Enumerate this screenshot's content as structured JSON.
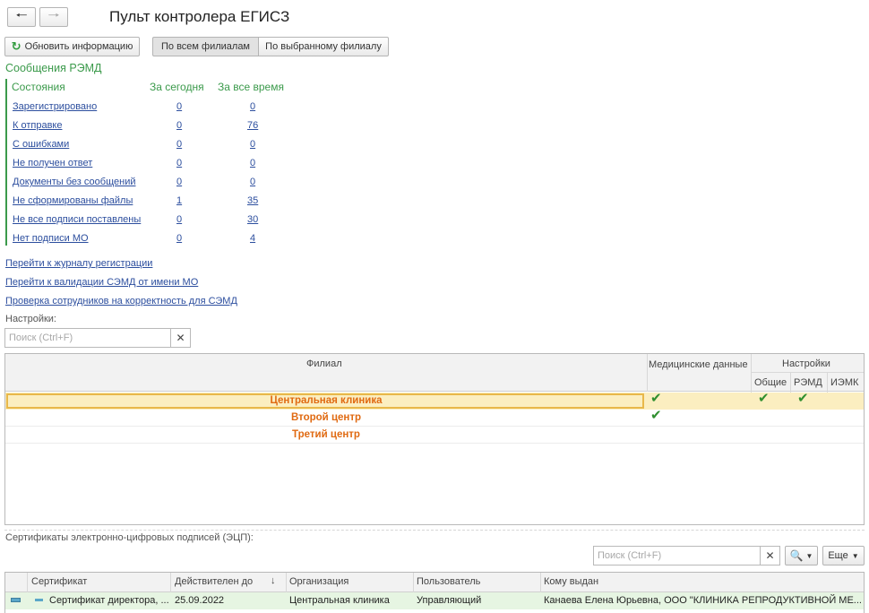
{
  "window": {
    "title": "Пульт контролера ЕГИСЗ"
  },
  "toolbar": {
    "refresh_label": "Обновить информацию",
    "filter_all": "По всем филиалам",
    "filter_selected": "По выбранному филиалу"
  },
  "remd": {
    "section_title": "Сообщения РЭМД",
    "header": {
      "state": "Состояния",
      "today": "За сегодня",
      "all_time": "За все время"
    },
    "rows": [
      {
        "label": "Зарегистрировано",
        "today": "0",
        "all": "0"
      },
      {
        "label": "К отправке",
        "today": "0",
        "all": "76"
      },
      {
        "label": "С ошибками",
        "today": "0",
        "all": "0"
      },
      {
        "label": "Не получен ответ",
        "today": "0",
        "all": "0"
      },
      {
        "label": "Документы без сообщений",
        "today": "0",
        "all": "0"
      },
      {
        "label": "Не сформированы файлы",
        "today": "1",
        "all": "35"
      },
      {
        "label": "Не все подписи поставлены",
        "today": "0",
        "all": "30"
      },
      {
        "label": "Нет подписи МО",
        "today": "0",
        "all": "4"
      }
    ]
  },
  "links": {
    "journal": "Перейти к журналу регистрации",
    "validation": "Перейти к валидации СЭМД от имени МО",
    "employees": "Проверка сотрудников на корректность для СЭМД"
  },
  "settings": {
    "label": "Настройки:",
    "search_placeholder": "Поиск (Ctrl+F)",
    "columns": {
      "branch": "Филиал",
      "medical": "Медицинские данные",
      "settings": "Настройки",
      "general": "Общие",
      "remd": "РЭМД",
      "iemk": "ИЭМК"
    },
    "rows": [
      {
        "name": "Центральная клиника",
        "medical": "✔",
        "general": "✔",
        "remd": "✔",
        "iemk": ""
      },
      {
        "name": "Второй центр",
        "medical": "✔",
        "general": "",
        "remd": "",
        "iemk": ""
      },
      {
        "name": "Третий центр",
        "medical": "",
        "general": "",
        "remd": "",
        "iemk": ""
      }
    ]
  },
  "certificates": {
    "label": "Сертификаты электронно-цифровых подписей (ЭЦП):",
    "search_placeholder": "Поиск (Ctrl+F)",
    "more_label": "Еще",
    "columns": {
      "cert": "Сертификат",
      "valid": "Действителен до",
      "org": "Организация",
      "user": "Пользователь",
      "issued": "Кому выдан"
    },
    "rows": [
      {
        "cert": "Сертификат директора, ...",
        "valid": "25.09.2022",
        "org": "Центральная клиника",
        "user": "Управляющий",
        "issued": "Канаева Елена Юрьевна, ООО \"КЛИНИКА РЕПРОДУКТИВНОЙ МЕ..."
      }
    ]
  },
  "colors": {
    "accent_green": "#3b9a4b",
    "link_blue": "#2c4e9e",
    "branch_orange": "#e06a12",
    "selected_row": "#fbeec0"
  }
}
